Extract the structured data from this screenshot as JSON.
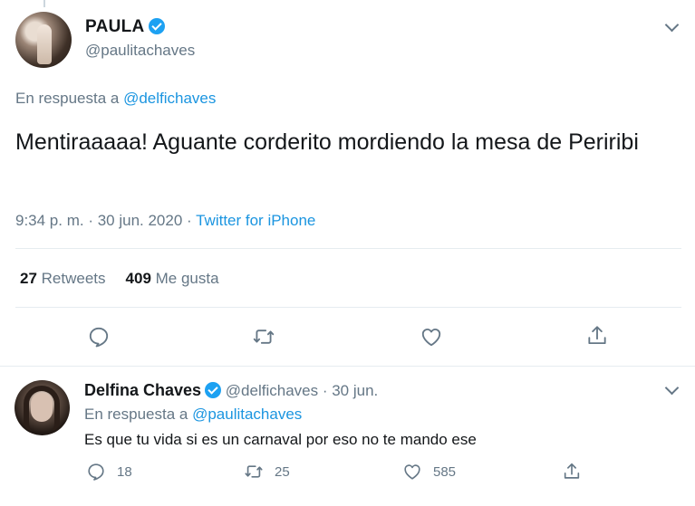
{
  "main_tweet": {
    "display_name": "PAULA",
    "handle": "@paulitachaves",
    "reply_prefix": "En respuesta a ",
    "reply_mention": "@delfichaves",
    "text": "Mentiraaaaa! Aguante corderito mordiendo la mesa de Periribi",
    "timestamp": "9:34 p. m. · 30 jun. 2020 · ",
    "source": "Twitter for iPhone",
    "retweet_count": "27",
    "retweet_label": "Retweets",
    "like_count": "409",
    "like_label": "Me gusta"
  },
  "reply_tweet": {
    "display_name": "Delfina Chaves",
    "handle": "@delfichaves",
    "date": " · 30 jun.",
    "reply_prefix": "En respuesta a ",
    "reply_mention": "@paulitachaves",
    "text": "Es que tu vida si es un carnaval por eso no te mando ese",
    "reply_count": "18",
    "retweet_count": "25",
    "like_count": "585"
  },
  "colors": {
    "accent": "#1b95e0",
    "verified": "#1da1f2",
    "secondary_text": "#657786",
    "divider": "#e6ecf0"
  },
  "icons": [
    "verified-badge-icon",
    "chevron-down-icon",
    "reply-icon",
    "retweet-icon",
    "like-icon",
    "share-icon"
  ]
}
